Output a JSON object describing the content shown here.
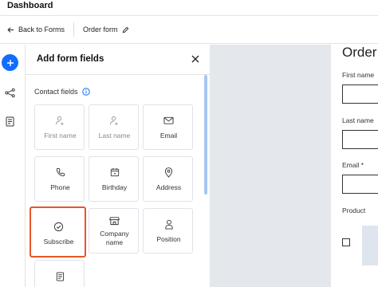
{
  "header": {
    "title": "Dashboard"
  },
  "toolbar": {
    "back_label": "Back to Forms",
    "form_name": "Order form"
  },
  "panel": {
    "title": "Add form fields",
    "section_label": "Contact fields",
    "fields": [
      {
        "label": "First name",
        "icon": "person-add-icon",
        "disabled": true
      },
      {
        "label": "Last name",
        "icon": "person-add-icon",
        "disabled": true
      },
      {
        "label": "Email",
        "icon": "envelope-icon"
      },
      {
        "label": "Phone",
        "icon": "phone-icon"
      },
      {
        "label": "Birthday",
        "icon": "calendar-icon"
      },
      {
        "label": "Address",
        "icon": "location-pin-icon"
      },
      {
        "label": "Subscribe",
        "icon": "check-circle-icon",
        "selected": true
      },
      {
        "label_line1": "Company",
        "label_line2": "name",
        "icon": "store-icon"
      },
      {
        "label": "Position",
        "icon": "person-icon"
      },
      {
        "label": "",
        "icon": "document-icon"
      }
    ]
  },
  "preview": {
    "title": "Order",
    "first_name_label": "First name",
    "last_name_label": "Last name",
    "email_label": "Email *",
    "product_label": "Product"
  },
  "colors": {
    "accent": "#116dff",
    "selection": "#e8562a",
    "canvas": "#e4e7eb"
  }
}
